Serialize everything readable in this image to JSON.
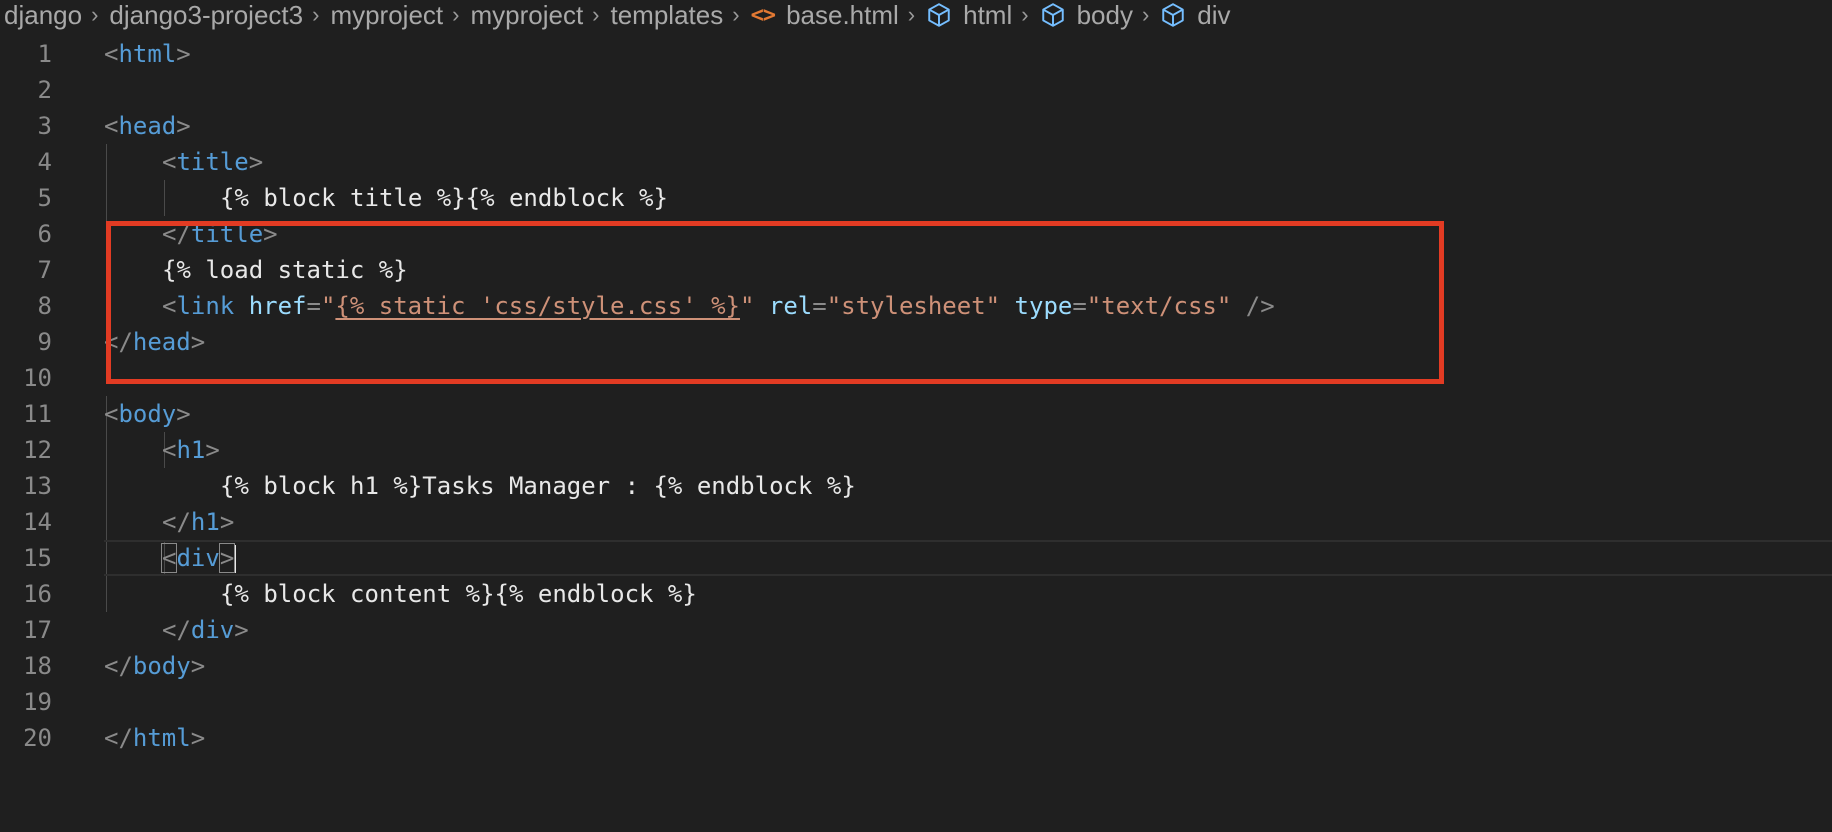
{
  "breadcrumb": {
    "items": [
      "django",
      "django3-project3",
      "myproject",
      "myproject",
      "templates",
      "base.html",
      "html",
      "body",
      "div"
    ],
    "file_icon": "html-file-icon",
    "element_icon": "symbol-cube-icon"
  },
  "editor": {
    "line_numbers": [
      "1",
      "2",
      "3",
      "4",
      "5",
      "6",
      "7",
      "8",
      "9",
      "10",
      "11",
      "12",
      "13",
      "14",
      "15",
      "16",
      "17",
      "18",
      "19",
      "20"
    ],
    "tokens": {
      "l1_tag": "html",
      "l3_tag": "head",
      "l4_tag": "title",
      "l5_text": "{% block title %}{% endblock %}",
      "l6_tag": "title",
      "l7_text": "{% load static %}",
      "l8_tag": "link",
      "l8_attr1": "href",
      "l8_q1": "\"",
      "l8_val1": "{% static 'css/style.css' %}",
      "l8_q2": "\"",
      "l8_attr2": "rel",
      "l8_val2": "\"stylesheet\"",
      "l8_attr3": "type",
      "l8_val3": "\"text/css\"",
      "l9_tag": "head",
      "l11_tag": "body",
      "l12_tag": "h1",
      "l13_text": "{% block h1 %}Tasks Manager : {% endblock %}",
      "l14_tag": "h1",
      "l15_tag": "div",
      "l16_text": "{% block content %}{% endblock %}",
      "l17_tag": "div",
      "l18_tag": "body",
      "l20_tag": "html"
    }
  },
  "colors": {
    "background": "#1f1f1f",
    "tag": "#569cd6",
    "attribute": "#9cdcfe",
    "string": "#ce9178",
    "punctuation": "#8a8a8a",
    "annotation_box": "#e23b23"
  }
}
